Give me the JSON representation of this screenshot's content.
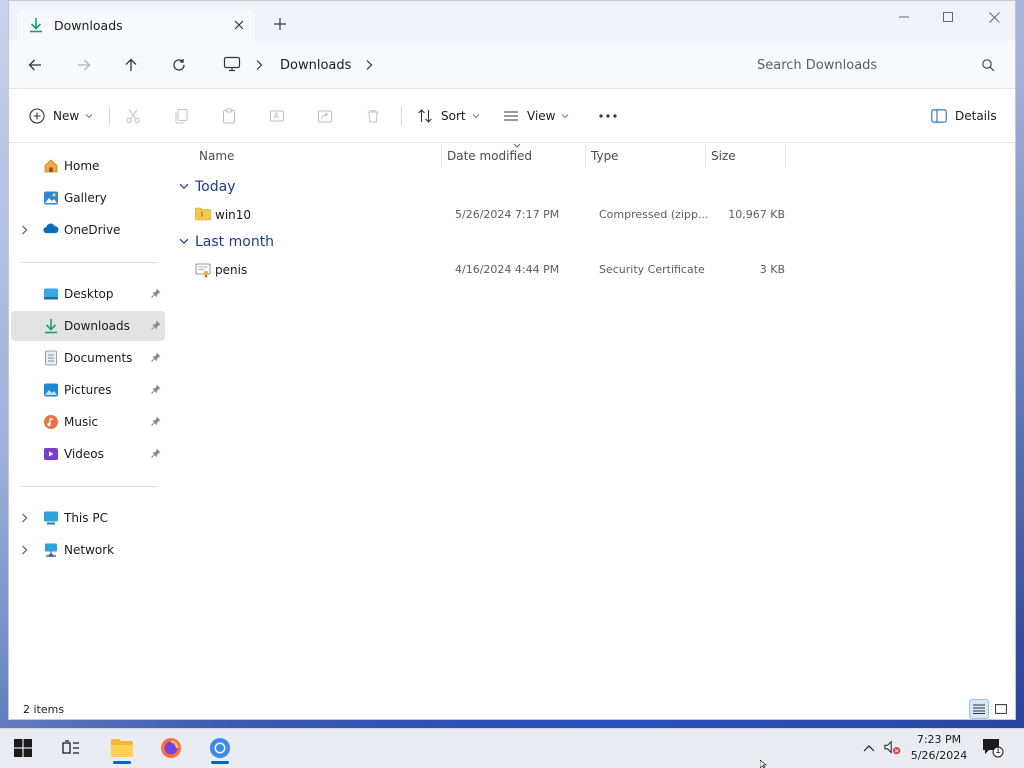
{
  "window": {
    "tab_title": "Downloads",
    "controls": {
      "minimize": "minimize",
      "maximize": "maximize",
      "close": "close"
    }
  },
  "address": {
    "breadcrumb": [
      "Downloads"
    ],
    "search_placeholder": "Search Downloads"
  },
  "commandbar": {
    "new_label": "New",
    "sort_label": "Sort",
    "view_label": "View",
    "details_label": "Details"
  },
  "nav": {
    "home": "Home",
    "gallery": "Gallery",
    "onedrive": "OneDrive",
    "desktop": "Desktop",
    "downloads": "Downloads",
    "documents": "Documents",
    "pictures": "Pictures",
    "music": "Music",
    "videos": "Videos",
    "this_pc": "This PC",
    "network": "Network"
  },
  "columns": {
    "name": "Name",
    "date_modified": "Date modified",
    "type": "Type",
    "size": "Size"
  },
  "groups": [
    {
      "label": "Today",
      "files": [
        {
          "name": "win10",
          "date": "5/26/2024 7:17 PM",
          "type": "Compressed (zipp...",
          "size": "10,967 KB",
          "icon": "zip-folder-icon"
        }
      ]
    },
    {
      "label": "Last month",
      "files": [
        {
          "name": "penis",
          "date": "4/16/2024 4:44 PM",
          "type": "Security Certificate",
          "size": "3 KB",
          "icon": "certificate-icon"
        }
      ]
    }
  ],
  "status": {
    "item_count": "2 items"
  },
  "taskbar": {
    "time": "7:23 PM",
    "date": "5/26/2024",
    "notification_count": "1"
  },
  "colors": {
    "accent": "#0067c0",
    "selected_nav": "#e3e3e3",
    "group_header": "#1f3a8a"
  }
}
